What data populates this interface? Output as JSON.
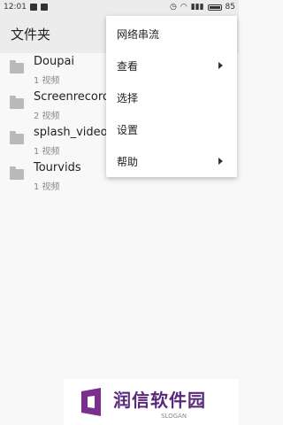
{
  "status": {
    "time": "12:01",
    "battery": "85"
  },
  "appbar": {
    "title": "文件夹"
  },
  "folders": [
    {
      "name": "Doupai",
      "count": "1 视频"
    },
    {
      "name": "Screenrecords",
      "count": "2 视频"
    },
    {
      "name": "splash_video",
      "count": "1 视频"
    },
    {
      "name": "Tourvids",
      "count": "1 视频"
    }
  ],
  "menu": {
    "items": [
      {
        "label": "网络串流"
      },
      {
        "label": "查看"
      },
      {
        "label": "选择"
      },
      {
        "label": "设置"
      },
      {
        "label": "帮助"
      }
    ]
  },
  "watermark": {
    "brand": "润信软件园",
    "slogan": "SLOGAN",
    "color": "#5a2a7a"
  }
}
